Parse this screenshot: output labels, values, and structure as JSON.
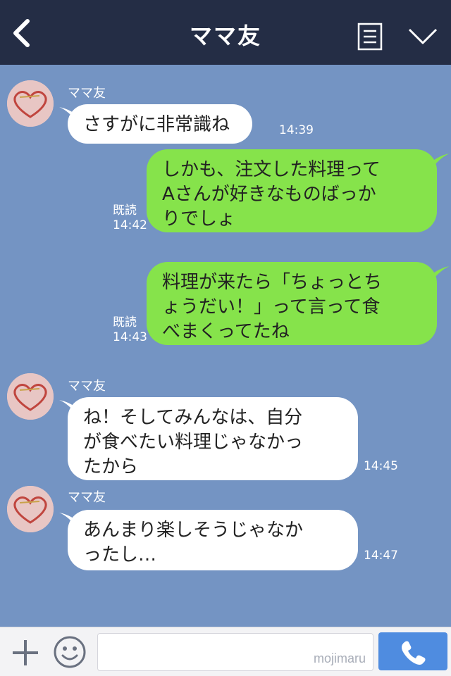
{
  "header": {
    "title": "ママ友",
    "back_icon": "back-chevron-icon",
    "notes_icon": "notes-icon",
    "more_icon": "chevron-down-icon",
    "color": "#242d45"
  },
  "colors": {
    "background": "#7494c3",
    "incoming_bubble": "#ffffff",
    "outgoing_bubble": "#86e34b",
    "call_button": "#4f8ce0"
  },
  "messages": [
    {
      "direction": "incoming",
      "sender": "ママ友",
      "text": "さすがに非常識ね",
      "time": "14:39"
    },
    {
      "direction": "outgoing",
      "read": "既読",
      "text": "しかも、注文した料理って\nAさんが好きなものばっか\nりでしょ",
      "time": "14:42"
    },
    {
      "direction": "outgoing",
      "read": "既読",
      "text": "料理が来たら「ちょっとち\nょうだい！」って言って食\nべまくってたね",
      "time": "14:43"
    },
    {
      "direction": "incoming",
      "sender": "ママ友",
      "text": "ね！そしてみんなは、自分\nが食べたい料理じゃなかっ\nたから",
      "time": "14:45"
    },
    {
      "direction": "incoming",
      "sender": "ママ友",
      "text": "あんまり楽しそうじゃなか\nったし…",
      "time": "14:47"
    }
  ],
  "input": {
    "placeholder": "",
    "watermark": "mojimaru",
    "plus_icon": "plus-icon",
    "emoji_icon": "smiley-icon",
    "call_icon": "phone-icon"
  }
}
